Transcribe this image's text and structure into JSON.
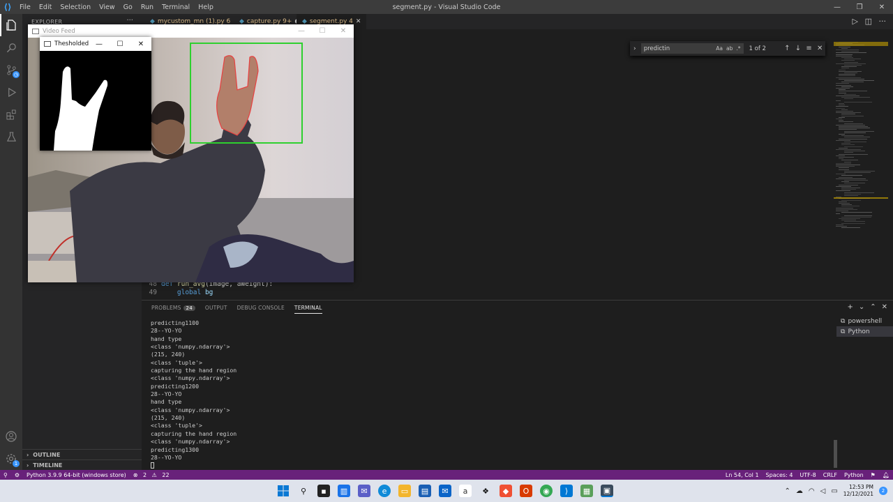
{
  "window": {
    "title": "segment.py - Visual Studio Code",
    "menu": [
      "File",
      "Edit",
      "Selection",
      "View",
      "Go",
      "Run",
      "Terminal",
      "Help"
    ]
  },
  "sidebar": {
    "header": "EXPLORER",
    "sections": [
      "OUTLINE",
      "TIMELINE"
    ]
  },
  "tabs": [
    {
      "label": "mycustom_mn (1).py 6",
      "color": "#e2c08d"
    },
    {
      "label": "capture.py 9+",
      "color": "#e2c08d"
    },
    {
      "label": "segment.py 4",
      "color": "#e2c08d"
    }
  ],
  "find": {
    "query": "predictin",
    "options": [
      "Aa",
      "ab",
      ".*"
    ],
    "count": "1 of 2"
  },
  "code": {
    "lines": [
      {
        "num": "48",
        "kw": "def",
        "fn": "run_avg",
        "rest": "(image, aWeight):"
      },
      {
        "num": "49",
        "kw": "global",
        "var": "bg"
      }
    ]
  },
  "panel": {
    "tabs": [
      "PROBLEMS",
      "OUTPUT",
      "DEBUG CONSOLE",
      "TERMINAL"
    ],
    "problems_count": "24",
    "active_tab": "TERMINAL",
    "terminal_lines": [
      "predicting1100",
      "28--YO-YO",
      "hand type",
      "<class 'numpy.ndarray'>",
      "(215, 240)",
      "<class 'tuple'>",
      "capturing the hand region",
      "<class 'numpy.ndarray'>",
      "predicting1200",
      "28--YO-YO",
      "hand type",
      "<class 'numpy.ndarray'>",
      "(215, 240)",
      "<class 'tuple'>",
      "capturing the hand region",
      "<class 'numpy.ndarray'>",
      "predicting1300",
      "28--YO-YO"
    ],
    "terminals": [
      "powershell",
      "Python"
    ]
  },
  "status": {
    "interpreter": "Python 3.9.9 64-bit (windows store)",
    "errors": "2",
    "warnings": "22",
    "position": "Ln 54, Col 1",
    "spaces": "Spaces: 4",
    "encoding": "UTF-8",
    "eol": "CRLF",
    "language": "Python",
    "color": "#68217a"
  },
  "video_window": {
    "title": "Video Feed"
  },
  "threshold_window": {
    "title": "Thesholded"
  },
  "taskbar": {
    "time": "12:53 PM",
    "date": "12/12/2021",
    "notifications": "2"
  }
}
